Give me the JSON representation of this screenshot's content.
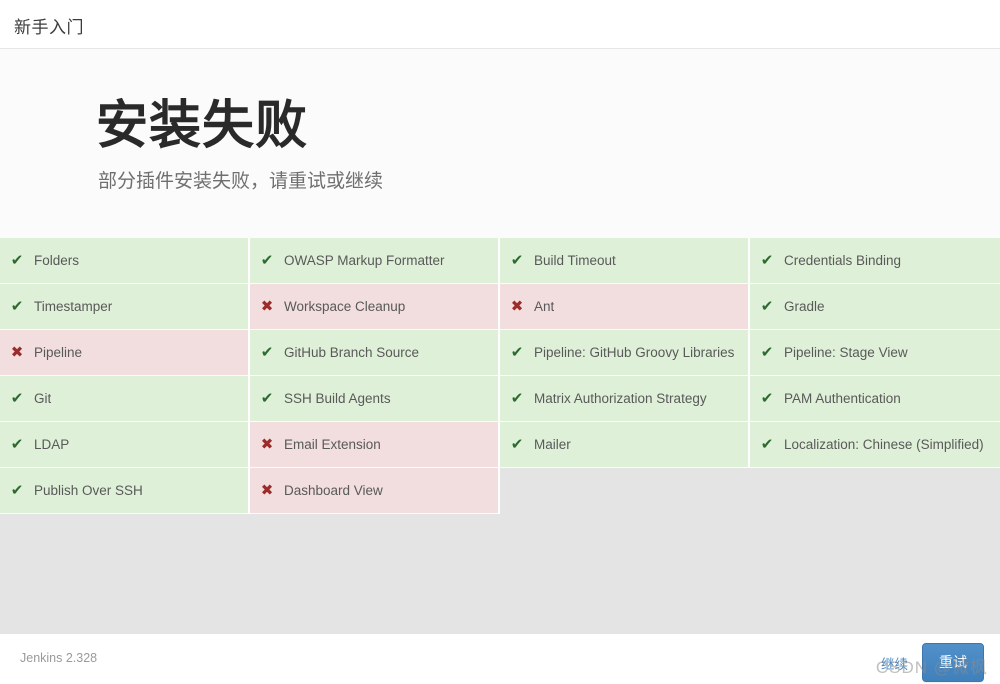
{
  "topbar": {
    "title": "新手入门"
  },
  "setup": {
    "title": "安装失败",
    "subtitle": "部分插件安装失败，请重试或继续",
    "retry_label": "重试"
  },
  "icons": {
    "check": "✔",
    "cross": "✖",
    "check_name": "check-icon",
    "cross_name": "cross-icon"
  },
  "colors": {
    "success_bg": "#dff0d8",
    "failure_bg": "#f2dede",
    "success_icon": "#2c6b2f",
    "failure_icon": "#9c2b2b",
    "primary_button": "#4a87c1",
    "link": "#4a87c1",
    "page_bg": "#fbfbfb",
    "grid_bg": "#e4e4e4"
  },
  "plugins": {
    "columns": [
      {
        "rows": [
          {
            "name": "Folders",
            "status": "success"
          },
          {
            "name": "Timestamper",
            "status": "success"
          },
          {
            "name": "Pipeline",
            "status": "failure"
          },
          {
            "name": "Git",
            "status": "success"
          },
          {
            "name": "LDAP",
            "status": "success"
          },
          {
            "name": "Publish Over SSH",
            "status": "success"
          }
        ]
      },
      {
        "rows": [
          {
            "name": "OWASP Markup Formatter",
            "status": "success"
          },
          {
            "name": "Workspace Cleanup",
            "status": "failure"
          },
          {
            "name": "GitHub Branch Source",
            "status": "success"
          },
          {
            "name": "SSH Build Agents",
            "status": "success"
          },
          {
            "name": "Email Extension",
            "status": "failure"
          },
          {
            "name": "Dashboard View",
            "status": "failure"
          }
        ]
      },
      {
        "rows": [
          {
            "name": "Build Timeout",
            "status": "success"
          },
          {
            "name": "Ant",
            "status": "failure"
          },
          {
            "name": "Pipeline: GitHub Groovy Libraries",
            "status": "success"
          },
          {
            "name": "Matrix Authorization Strategy",
            "status": "success"
          },
          {
            "name": "Mailer",
            "status": "success"
          }
        ]
      },
      {
        "rows": [
          {
            "name": "Credentials Binding",
            "status": "success"
          },
          {
            "name": "Gradle",
            "status": "success"
          },
          {
            "name": "Pipeline: Stage View",
            "status": "success"
          },
          {
            "name": "PAM Authentication",
            "status": "success"
          },
          {
            "name": "Localization: Chinese (Simplified)",
            "status": "success"
          }
        ]
      }
    ]
  },
  "footer": {
    "version": "Jenkins 2.328",
    "continue_label": "继续",
    "retry_label": "重试"
  },
  "watermark": {
    "text": "CSDN @微枫"
  }
}
